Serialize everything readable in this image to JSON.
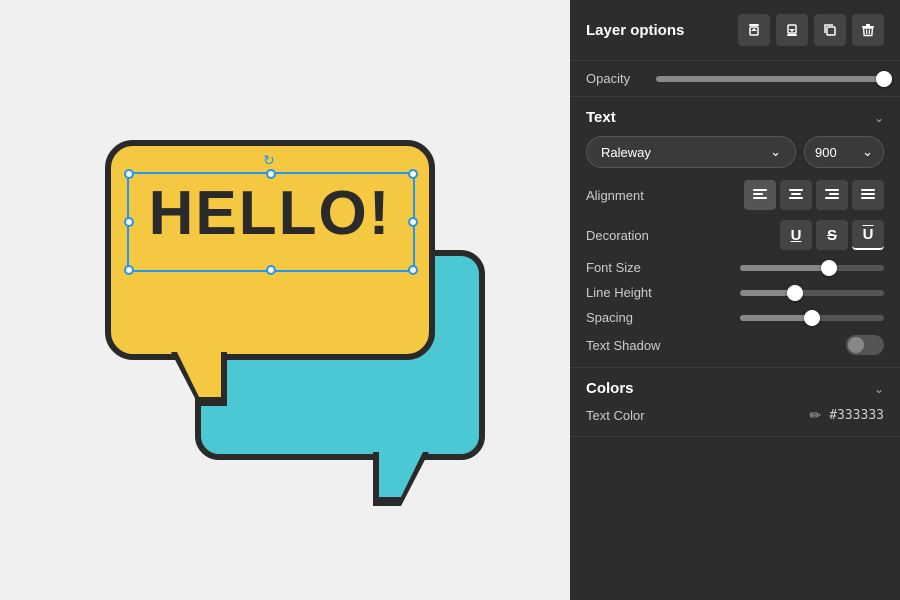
{
  "canvas": {
    "hello_text": "HELLO!"
  },
  "panel": {
    "layer_options": {
      "title": "Layer options",
      "buttons": [
        {
          "name": "align-top",
          "symbol": "⬆"
        },
        {
          "name": "align-bottom",
          "symbol": "⬇"
        },
        {
          "name": "duplicate",
          "symbol": "⧉"
        },
        {
          "name": "delete",
          "symbol": "🗑"
        }
      ]
    },
    "opacity": {
      "label": "Opacity",
      "value": 100,
      "percent": 100
    },
    "text": {
      "title": "Text",
      "font_name": "Raleway",
      "font_weight": "900",
      "alignment_label": "Alignment",
      "decoration_label": "Decoration",
      "font_size_label": "Font Size",
      "line_height_label": "Line Height",
      "spacing_label": "Spacing",
      "text_shadow_label": "Text Shadow",
      "font_size_value": 62,
      "line_height_value": 40,
      "spacing_value": 50,
      "shadow_on": false
    },
    "colors": {
      "title": "Colors",
      "text_color_label": "Text Color",
      "text_color_value": "#333333"
    }
  }
}
